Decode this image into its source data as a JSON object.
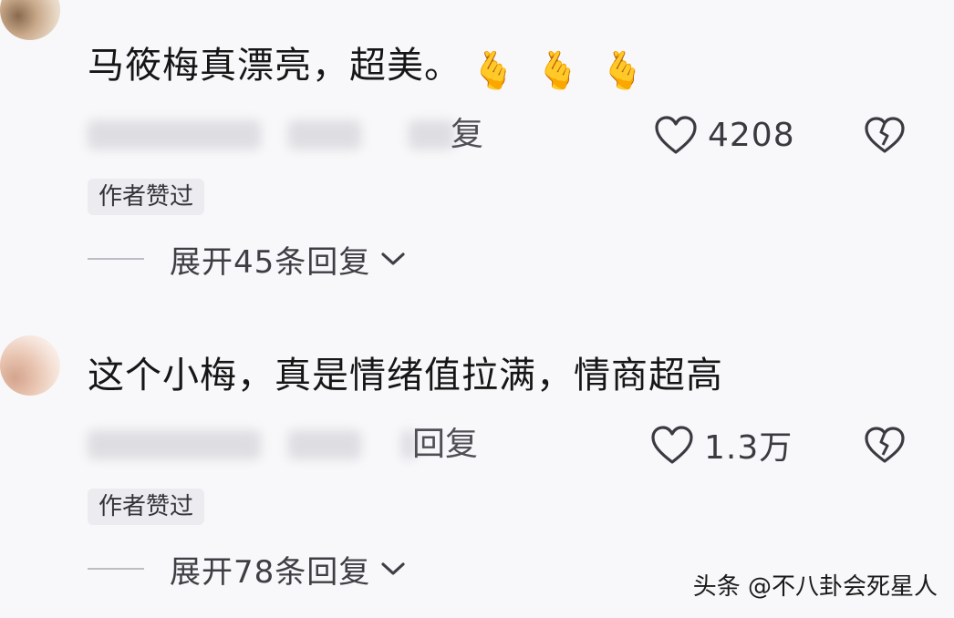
{
  "comments": [
    {
      "text": "马筱梅真漂亮，超美。",
      "emoji": [
        "🫰",
        "🫰",
        "🫰"
      ],
      "reply_label": "复",
      "like_count": "4208",
      "author_badge": "作者赞过",
      "expand_label": "展开45条回复"
    },
    {
      "text": "这个小梅，真是情绪值拉满，情商超高",
      "emoji": [],
      "reply_label": "回复",
      "like_count": "1.3万",
      "author_badge": "作者赞过",
      "expand_label": "展开78条回复"
    }
  ],
  "watermark": "头条 @不八卦会死星人",
  "icons": {
    "like": "heart-outline-icon",
    "dislike": "broken-heart-icon",
    "expand": "chevron-down-icon"
  },
  "colors": {
    "background": "#f8f8fa",
    "text": "#161616",
    "muted": "#4f4f55",
    "badge_bg": "#ececf0"
  }
}
